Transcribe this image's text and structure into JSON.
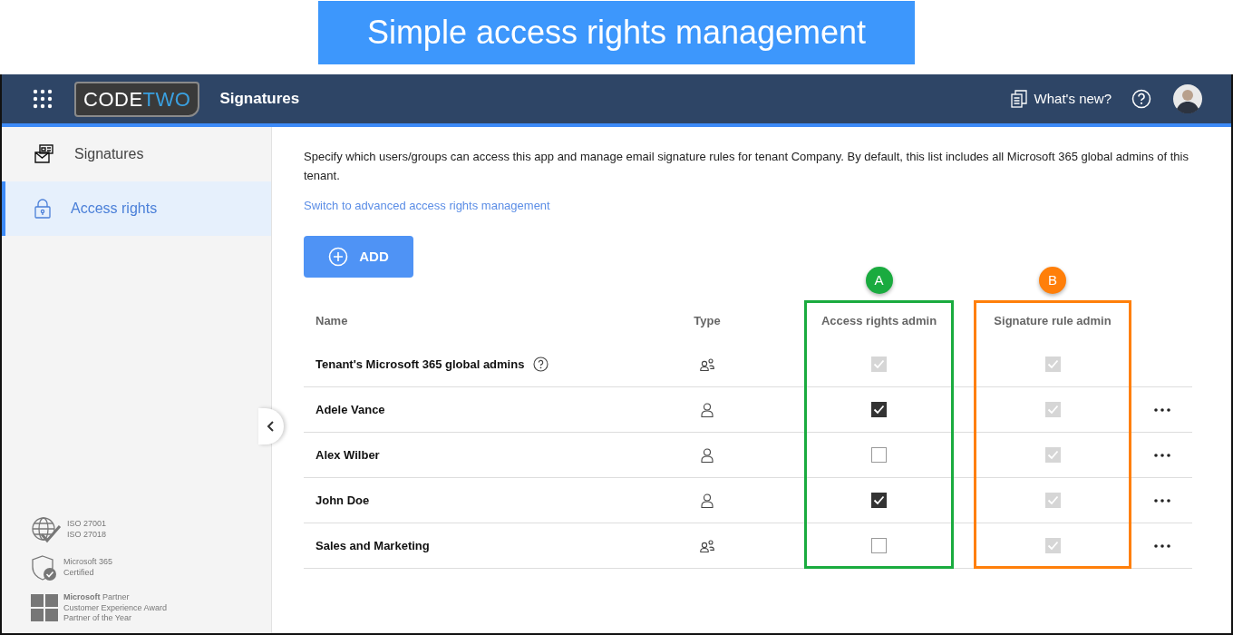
{
  "banner": {
    "title": "Simple access rights management"
  },
  "header": {
    "logo": {
      "text": "CODE",
      "accent": "TWO"
    },
    "app_title": "Signatures",
    "whats_new": "What's new?"
  },
  "sidebar": {
    "items": [
      {
        "label": "Signatures",
        "kind": "signature",
        "selected": false
      },
      {
        "label": "Access rights",
        "kind": "lock",
        "selected": true
      }
    ],
    "certifications": [
      {
        "kind": "iso",
        "lines": [
          "ISO 27001",
          "ISO 27018"
        ]
      },
      {
        "kind": "shield",
        "lines": [
          "Microsoft 365",
          "Certified"
        ]
      },
      {
        "kind": "windows",
        "lines": [
          "**Microsoft** Partner",
          "Customer Experience Award",
          "Partner of the Year"
        ]
      }
    ]
  },
  "content": {
    "description": "Specify which users/groups can access this app and manage email signature rules for tenant Company. By default, this list includes all Microsoft 365 global admins of this tenant.",
    "advanced_link": "Switch to advanced access rights management",
    "add_button": "ADD",
    "annotations": [
      {
        "label": "A",
        "color": "#1aab3f"
      },
      {
        "label": "B",
        "color": "#ff7f0a"
      }
    ],
    "table": {
      "columns": [
        "Name",
        "Type",
        "Access rights admin",
        "Signature rule admin"
      ],
      "rows": [
        {
          "name": "Tenant's Microsoft 365 global admins",
          "help": true,
          "kind": "group",
          "access": {
            "checked": true,
            "disabled": true
          },
          "signature": {
            "checked": true,
            "disabled": true
          },
          "menu": false
        },
        {
          "name": "Adele Vance",
          "help": false,
          "kind": "user",
          "access": {
            "checked": true,
            "disabled": false
          },
          "signature": {
            "checked": true,
            "disabled": true
          },
          "menu": true
        },
        {
          "name": "Alex Wilber",
          "help": false,
          "kind": "user",
          "access": {
            "checked": false,
            "disabled": false
          },
          "signature": {
            "checked": true,
            "disabled": true
          },
          "menu": true
        },
        {
          "name": "John Doe",
          "help": false,
          "kind": "user",
          "access": {
            "checked": true,
            "disabled": false
          },
          "signature": {
            "checked": true,
            "disabled": true
          },
          "menu": true
        },
        {
          "name": "Sales and Marketing",
          "help": false,
          "kind": "group",
          "access": {
            "checked": false,
            "disabled": false
          },
          "signature": {
            "checked": true,
            "disabled": true
          },
          "menu": true
        }
      ]
    }
  }
}
